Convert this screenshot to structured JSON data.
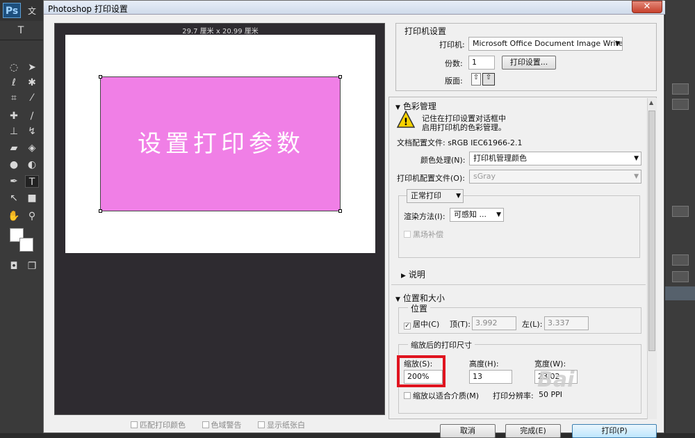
{
  "ps": {
    "logo": "Ps",
    "menu_first": "文",
    "tools": [
      "marquee-icon",
      "move-icon",
      "lasso-icon",
      "magic-wand-icon",
      "crop-icon",
      "eyedropper-icon",
      "healing-icon",
      "brush-icon",
      "stamp-icon",
      "history-brush-icon",
      "eraser-icon",
      "paint-bucket-icon",
      "blur-icon",
      "dodge-icon",
      "pen-icon",
      "type-icon",
      "path-select-icon",
      "shape-icon",
      "hand-icon",
      "zoom-icon"
    ],
    "type_tool_glyph": "T"
  },
  "dialog": {
    "title": "Photoshop 打印设置",
    "close": "✕",
    "preview": {
      "paper_size": "29.7 厘米 x 20.99 厘米",
      "image_text": "设置打印参数"
    },
    "bottom_checks": [
      "匹配打印颜色",
      "色域警告",
      "显示纸张白"
    ],
    "printer_setup": {
      "header": "打印机设置",
      "printer_label": "打印机:",
      "printer_value": "Microsoft Office Document Image Writer",
      "copies_label": "份数:",
      "copies_value": "1",
      "print_settings_button": "打印设置...",
      "layout_label": "版面:"
    },
    "color_management": {
      "header": "色彩管理",
      "warning_line1": "记住在打印设置对话框中",
      "warning_line2": "启用打印机的色彩管理。",
      "doc_profile": "文档配置文件: sRGB IEC61966-2.1",
      "color_handling_label": "颜色处理(N):",
      "color_handling_value": "打印机管理颜色",
      "printer_profile_label": "打印机配置文件(O):",
      "printer_profile_value": "sGray",
      "normal_print": "正常打印",
      "render_label": "渲染方法(I):",
      "render_value": "可感知",
      "render_extra": "...",
      "black_point": "黑场补偿"
    },
    "description": {
      "header": "说明"
    },
    "position_size": {
      "header": "位置和大小",
      "position_group": "位置",
      "center_label": "居中(C)",
      "top_label": "顶(T):",
      "top_value": "3.992",
      "left_label": "左(L):",
      "left_value": "3.337",
      "scaled_group": "缩放后的打印尺寸",
      "scale_label": "缩放(S):",
      "scale_value": "200%",
      "height_label": "高度(H):",
      "height_value": "13",
      "width_label": "宽度(W):",
      "width_value": "23.02",
      "fit_media": "缩放以适合介质(M)",
      "resolution_label": "打印分辨率:",
      "resolution_value": "50 PPI"
    },
    "buttons": {
      "cancel": "取消",
      "done": "完成(E)",
      "print": "打印(P)"
    },
    "watermark": "Bai"
  },
  "colors": {
    "image_fill": "#f07fe6",
    "highlight": "#e0141f"
  }
}
